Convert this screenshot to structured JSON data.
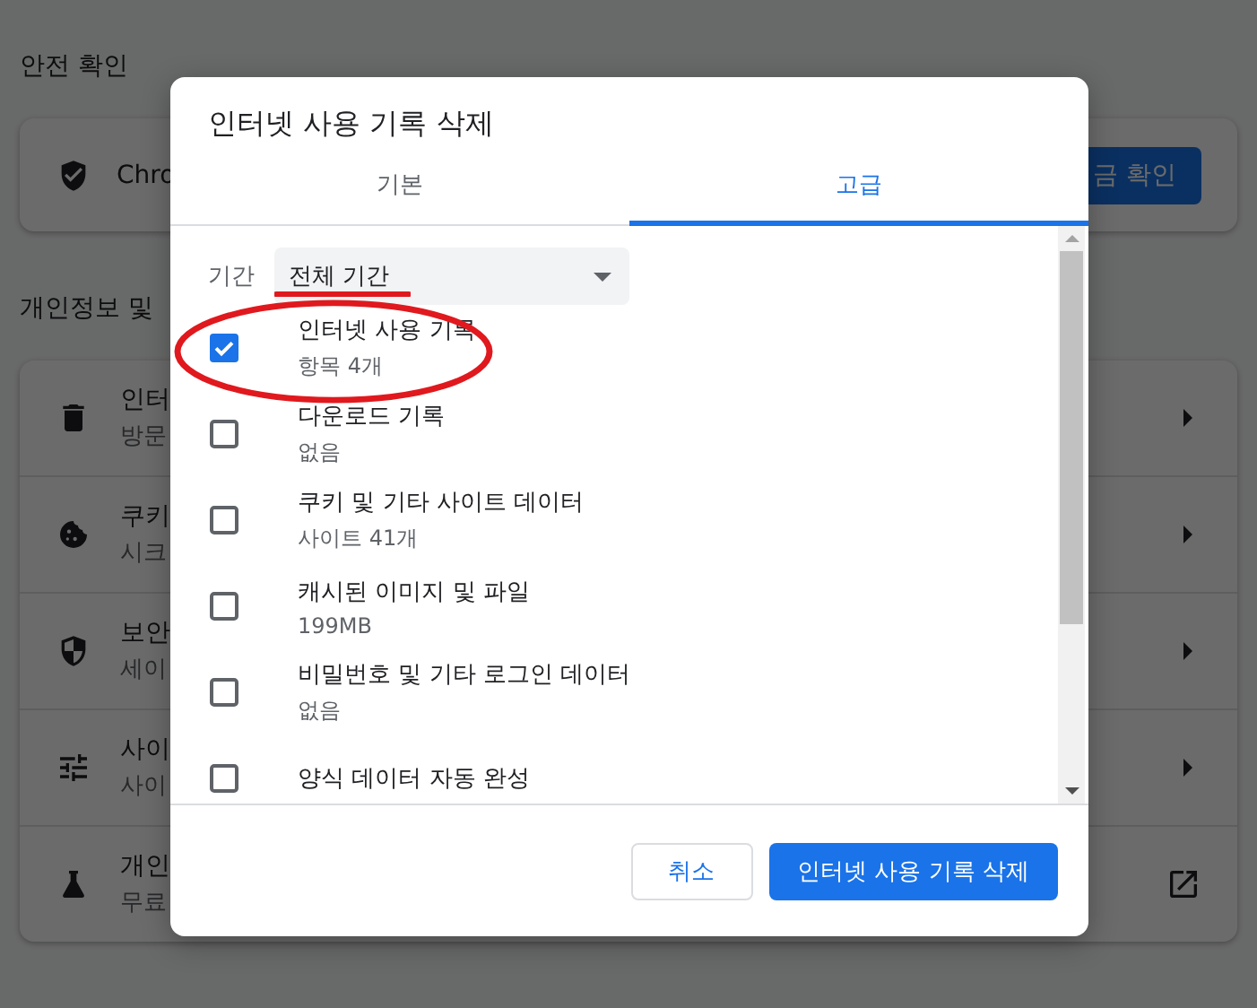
{
  "background": {
    "safety_heading": "안전 확인",
    "safety_card": {
      "text": "Chro",
      "button": "금 확인"
    },
    "privacy_heading": "개인정보 및",
    "privacy_rows": [
      {
        "title": "인터",
        "subtitle": "방문"
      },
      {
        "title": "쿠키",
        "subtitle": "시크"
      },
      {
        "title": "보안",
        "subtitle": "세이"
      },
      {
        "title": "사이",
        "subtitle": "사이"
      },
      {
        "title": "개인",
        "subtitle": "무료"
      }
    ]
  },
  "dialog": {
    "title": "인터넷 사용 기록 삭제",
    "tabs": [
      {
        "label": "기본",
        "selected": false
      },
      {
        "label": "고급",
        "selected": true
      }
    ],
    "period": {
      "label": "기간",
      "value": "전체 기간",
      "underlined": true
    },
    "items": [
      {
        "label": "인터넷 사용 기록",
        "detail": "항목 4개",
        "checked": true,
        "circled": true
      },
      {
        "label": "다운로드 기록",
        "detail": "없음",
        "checked": false,
        "circled": false
      },
      {
        "label": "쿠키 및 기타 사이트 데이터",
        "detail": "사이트 41개",
        "checked": false,
        "circled": false
      },
      {
        "label": "캐시된 이미지 및 파일",
        "detail": "199MB",
        "checked": false,
        "circled": false
      },
      {
        "label": "비밀번호 및 기타 로그인 데이터",
        "detail": "없음",
        "checked": false,
        "circled": false
      },
      {
        "label": "양식 데이터 자동 완성",
        "checked": false,
        "circled": false
      }
    ],
    "buttons": {
      "cancel": "취소",
      "confirm": "인터넷 사용 기록 삭제"
    }
  }
}
